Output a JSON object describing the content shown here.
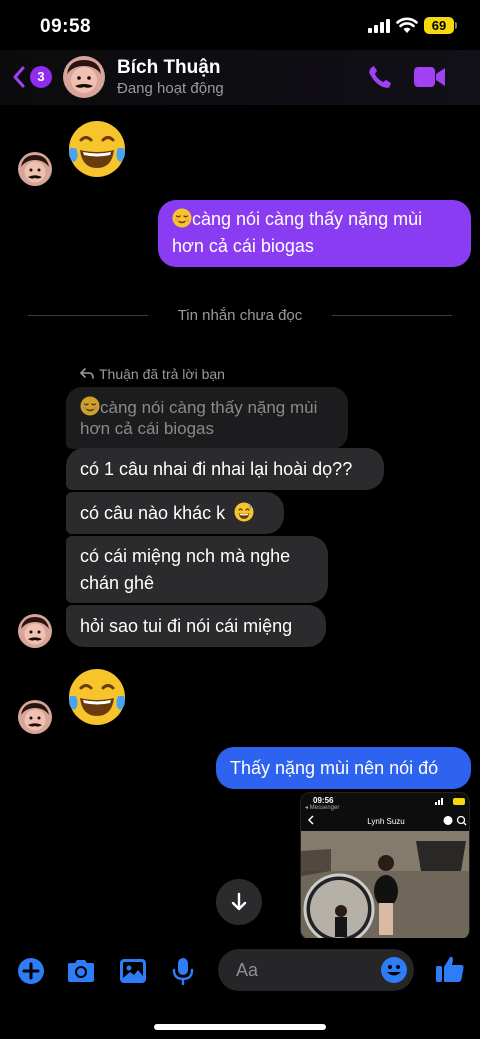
{
  "status_bar": {
    "time": "09:58",
    "battery": "69"
  },
  "header": {
    "unread_count": "3",
    "name": "Bích Thuận",
    "status": "Đang hoạt động"
  },
  "messages": {
    "outgoing_1": "càng nói càng thấy nặng mùi hơn cả cái biogas",
    "divider": "Tin nhắn chưa đọc",
    "reply_label": "Thuận đã trả lời bạn",
    "quoted": "càng nói càng thấy nặng mùi hơn cả cái biogas",
    "incoming_1": "có 1 câu nhai đi nhai lại hoài dọ??",
    "incoming_2": "có câu nào khác k",
    "incoming_3": "có cái miệng nch mà nghe chán ghê",
    "incoming_4": "hỏi sao tui đi nói cái miệng",
    "outgoing_2": "Thấy nặng mùi nên nói đó"
  },
  "attachment": {
    "time": "09:56",
    "back_label": "◂ Messenger",
    "title": "Lynh Suzu"
  },
  "composer": {
    "placeholder": "Aa"
  },
  "colors": {
    "accent_purple": "#8a3cf2",
    "bubble_blue": "#2e63f0",
    "bubble_incoming": "#2b2b2e",
    "icon_blue": "#2e7cf6",
    "header_purple": "#a140f5"
  }
}
